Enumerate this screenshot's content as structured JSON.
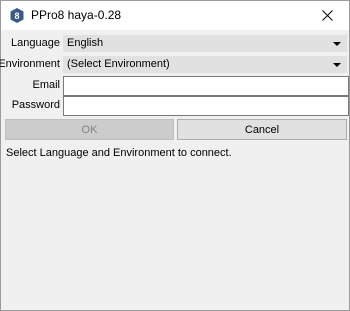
{
  "window": {
    "title": "PPro8 haya-0.28",
    "app_icon_glyph": "8"
  },
  "form": {
    "language": {
      "label": "Language",
      "value": "English"
    },
    "environment": {
      "label": "Environment",
      "value": "(Select Environment)"
    },
    "email": {
      "label": "Email",
      "value": ""
    },
    "password": {
      "label": "Password",
      "value": ""
    }
  },
  "buttons": {
    "ok_label": "OK",
    "cancel_label": "Cancel"
  },
  "status_text": "Select Language and Environment to connect.",
  "colors": {
    "titlebar_bg": "#ffffff",
    "dialog_bg": "#f0f0f0",
    "app_icon": "#3a5a86",
    "disabled_button": "#cccccc"
  }
}
